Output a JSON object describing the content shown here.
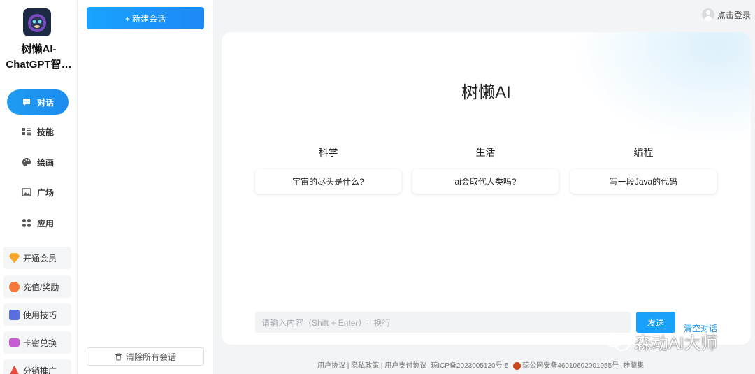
{
  "brand": {
    "name": "树懒AI-ChatGPT智能助手"
  },
  "nav": {
    "items": [
      {
        "label": "对话",
        "icon": "chat-icon",
        "active": true
      },
      {
        "label": "技能",
        "icon": "list-icon",
        "active": false
      },
      {
        "label": "绘画",
        "icon": "palette-icon",
        "active": false
      },
      {
        "label": "广场",
        "icon": "image-icon",
        "active": false
      },
      {
        "label": "应用",
        "icon": "apps-icon",
        "active": false
      }
    ],
    "buttons": [
      {
        "label": "开通会员",
        "icon": "diamond-icon"
      },
      {
        "label": "充值/奖励",
        "icon": "coin-icon"
      },
      {
        "label": "使用技巧",
        "icon": "book-icon"
      },
      {
        "label": "卡密兑换",
        "icon": "card-icon"
      },
      {
        "label": "分销推广",
        "icon": "network-icon"
      }
    ]
  },
  "sidebar": {
    "new_chat": "+ 新建会话",
    "clear_all": "清除所有会话"
  },
  "header": {
    "login": "点击登录"
  },
  "main": {
    "title": "树懒AI",
    "categories": [
      {
        "label": "科学",
        "suggestion": "宇宙的尽头是什么?"
      },
      {
        "label": "生活",
        "suggestion": "ai会取代人类吗?"
      },
      {
        "label": "编程",
        "suggestion": "写一段Java的代码"
      }
    ],
    "input_placeholder": "请输入内容（Shift + Enter）= 换行",
    "send": "发送",
    "clear": "清空对话"
  },
  "footer": {
    "links": "用户协议 | 隐私政策 | 用户支付协议",
    "icp": "琼ICP备2023005120号-5",
    "police": "琼公网安备46010602001955号",
    "extra": "神髓集"
  },
  "watermark": "森动AI大师",
  "colors": {
    "accent": "#1c9bf5",
    "background": "#f3f4f6"
  }
}
